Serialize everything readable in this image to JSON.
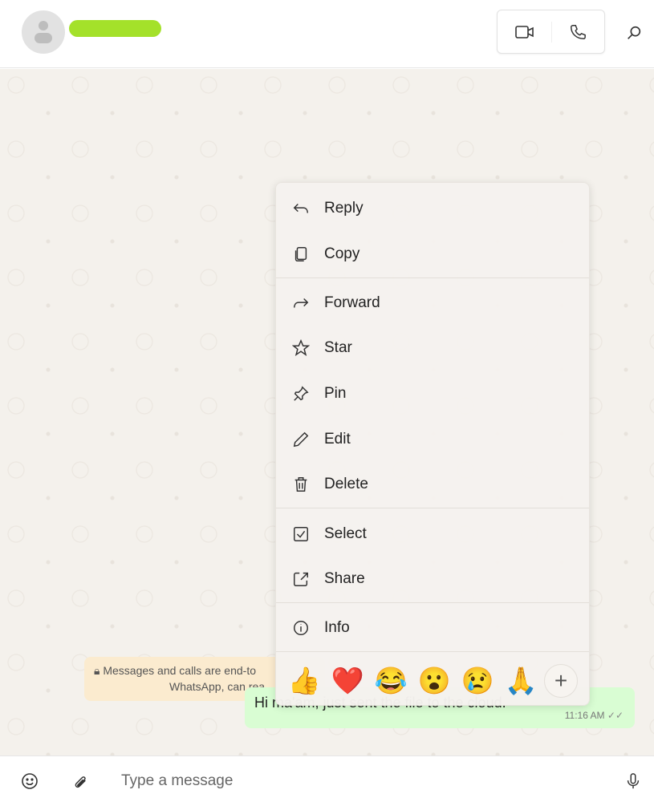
{
  "header": {
    "contact_name_redacted": true,
    "icons": [
      "video-call-icon",
      "voice-call-icon",
      "search-icon"
    ]
  },
  "chat": {
    "notice_line1": "Messages and calls are end-to",
    "notice_line2": "WhatsApp, can rea",
    "message": {
      "text": "Hi ma'am, just sent the file to the cloud.",
      "time": "11:16 AM",
      "status": "read"
    }
  },
  "menu": {
    "items": [
      {
        "label": "Reply",
        "icon": "reply-icon"
      },
      {
        "label": "Copy",
        "icon": "copy-icon"
      },
      {
        "label": "Forward",
        "icon": "forward-icon"
      },
      {
        "label": "Star",
        "icon": "star-icon"
      },
      {
        "label": "Pin",
        "icon": "pin-icon"
      },
      {
        "label": "Edit",
        "icon": "edit-icon"
      },
      {
        "label": "Delete",
        "icon": "delete-icon"
      },
      {
        "label": "Select",
        "icon": "select-icon"
      },
      {
        "label": "Share",
        "icon": "share-icon"
      },
      {
        "label": "Info",
        "icon": "info-icon"
      }
    ],
    "reactions": [
      "👍",
      "❤️",
      "😂",
      "😮",
      "😢",
      "🙏"
    ],
    "more": "+"
  },
  "footer": {
    "placeholder": "Type a message"
  },
  "colors": {
    "outgoing_bubble": "#d9fdd3",
    "notice": "#fbebcf",
    "name_highlight": "#a4e12a"
  }
}
